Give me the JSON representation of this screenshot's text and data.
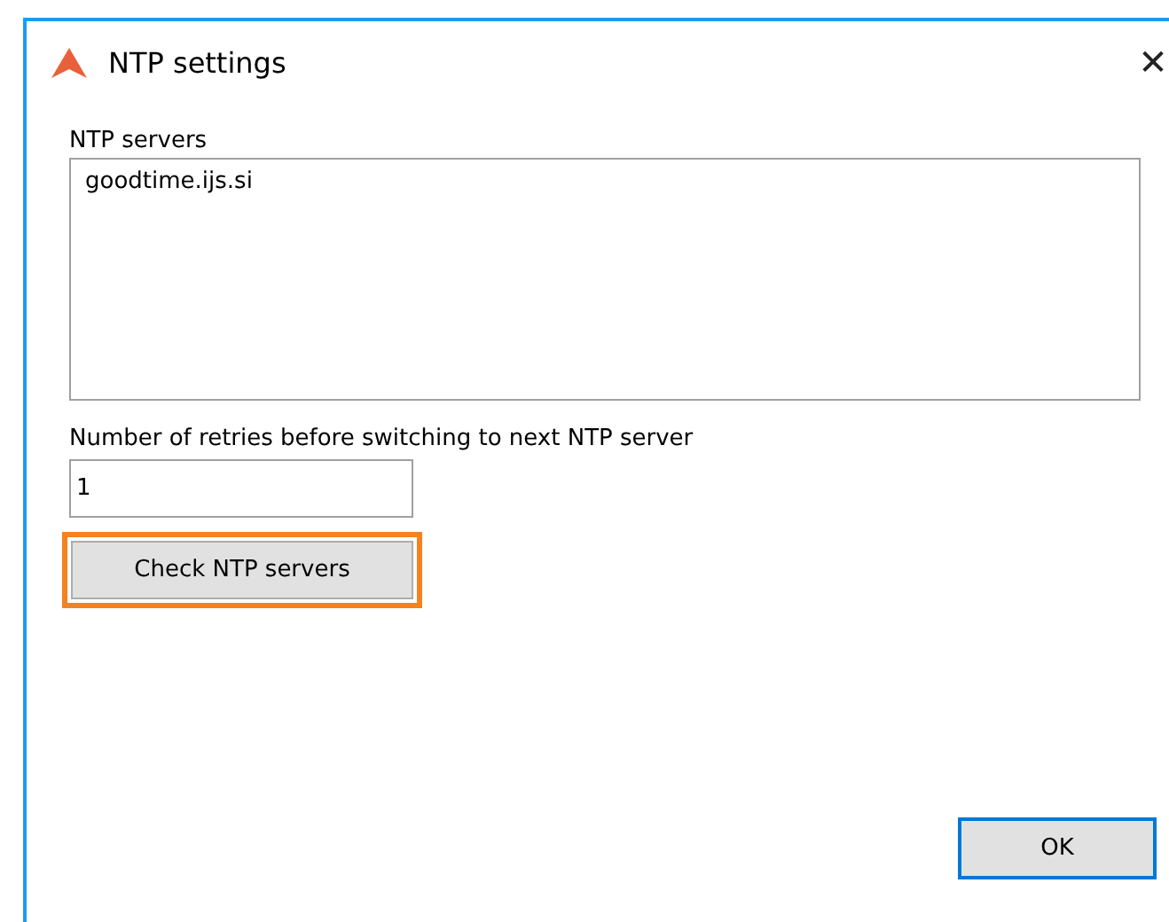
{
  "window": {
    "title": "NTP settings",
    "close": "✕"
  },
  "servers": {
    "label": "NTP servers",
    "value": "goodtime.ijs.si"
  },
  "retries": {
    "label": "Number of retries before switching to next NTP server",
    "value": "1"
  },
  "check_button": {
    "label": "Check NTP servers",
    "highlighted": true
  },
  "ok_button": {
    "label": "OK",
    "focused": true
  }
}
